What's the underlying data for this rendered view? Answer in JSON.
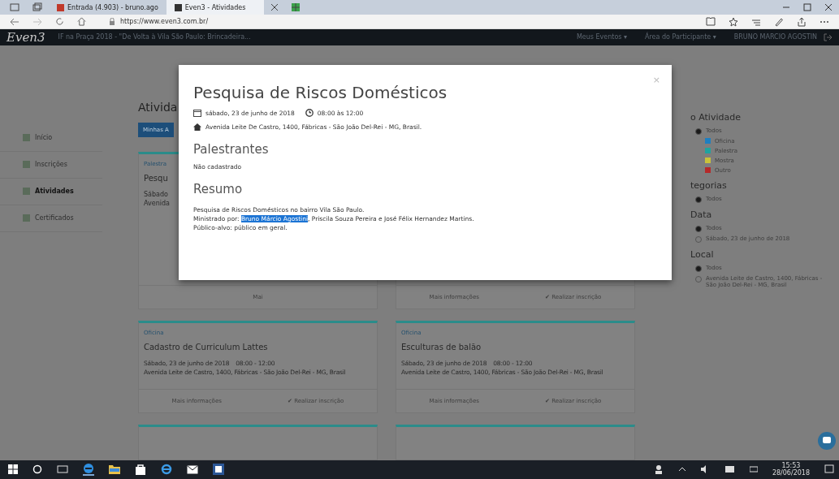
{
  "browser": {
    "tabs": [
      {
        "label": "Entrada (4.903) - bruno.ago",
        "selected": false
      },
      {
        "label": "Even3 - Atividades",
        "selected": true
      }
    ],
    "url_host": "https://www.even3.com.br/"
  },
  "navbar": {
    "logo": "Even3",
    "event_title": "IF na Praça 2018 - \"De Volta à Vila São Paulo: Brincadeira...",
    "menus": [
      "Meus Eventos ▾",
      "Área do Participante ▾"
    ],
    "user": "BRUNO MARCIO AGOSTIN"
  },
  "sidebar": {
    "items": [
      {
        "label": "Início",
        "selected": false
      },
      {
        "label": "Inscrições",
        "selected": false
      },
      {
        "label": "Atividades",
        "selected": true
      },
      {
        "label": "Certificados",
        "selected": false
      }
    ]
  },
  "main": {
    "heading": "Ativida",
    "button": "Minhas A",
    "cards": [
      {
        "type": "Palestra",
        "title": "Pesqu",
        "date": "Sábado",
        "place": "Avenida",
        "more": "Mai"
      },
      {
        "more": "Mais informações",
        "subscribe": "✔ Realizar inscrição"
      },
      {
        "type": "Oficina",
        "title": "Cadastro de Curriculum Lattes",
        "date": "Sábado, 23 de junho de 2018",
        "time": "08:00 - 12:00",
        "place": "Avenida Leite de Castro, 1400, Fábricas - São João Del-Rei - MG, Brasil",
        "more": "Mais informações",
        "subscribe": "✔ Realizar inscrição"
      },
      {
        "type": "Oficina",
        "title": "Esculturas de balão",
        "date": "Sábado, 23 de junho de 2018",
        "time": "08:00 - 12:00",
        "place": "Avenida Leite de Castro, 1400, Fábricas - São João Del-Rei - MG, Brasil",
        "more": "Mais informações",
        "subscribe": "✔ Realizar inscrição"
      }
    ]
  },
  "filters": [
    {
      "heading": "o Atividade",
      "options": [
        {
          "label": "Todos",
          "kind": "radio",
          "selected": true
        },
        {
          "label": "Oficina",
          "kind": "swatch",
          "color": "#1e7fc0"
        },
        {
          "label": "Palestra",
          "kind": "swatch",
          "color": "#1fa3a0"
        },
        {
          "label": "Mostra",
          "kind": "swatch",
          "color": "#c9c23a"
        },
        {
          "label": "Outro",
          "kind": "swatch",
          "color": "#b52a2a"
        }
      ]
    },
    {
      "heading": "tegorias",
      "options": [
        {
          "label": "Todos",
          "kind": "radio",
          "selected": true
        }
      ]
    },
    {
      "heading": "Data",
      "options": [
        {
          "label": "Todos",
          "kind": "radio",
          "selected": true
        },
        {
          "label": "Sábado, 23 de junho de 2018",
          "kind": "radio",
          "selected": false
        }
      ]
    },
    {
      "heading": "Local",
      "options": [
        {
          "label": "Todos",
          "kind": "radio",
          "selected": true
        },
        {
          "label": "Avenida Leite de Castro, 1400, Fábricas - São João Del-Rei - MG, Brasil",
          "kind": "radio",
          "selected": false
        }
      ]
    }
  ],
  "modal": {
    "title": "Pesquisa de Riscos Domésticos",
    "close": "×",
    "date": "sábado, 23 de junho de 2018",
    "time": "08:00 às 12:00",
    "address": "Avenida Leite De Castro, 1400, Fábricas - São João Del-Rei - MG, Brasil.",
    "speakers_heading": "Palestrantes",
    "speakers": "Não cadastrado",
    "summary_heading": "Resumo",
    "summary_lines": [
      [
        {
          "text": "Pesquisa de Riscos Domésticos no bairro Vila São Paulo.",
          "selected": false
        }
      ],
      [
        {
          "text": "Ministrado por: ",
          "selected": false
        },
        {
          "text": "Bruno Márcio Agostini",
          "selected": true
        },
        {
          "text": ", Priscila Souza Pereira e José Félix Hernandez Martins.",
          "selected": false
        }
      ],
      [
        {
          "text": "Público-alvo: público em geral.",
          "selected": false
        }
      ]
    ]
  },
  "taskbar": {
    "time": "15:53",
    "date": "28/06/2018"
  }
}
